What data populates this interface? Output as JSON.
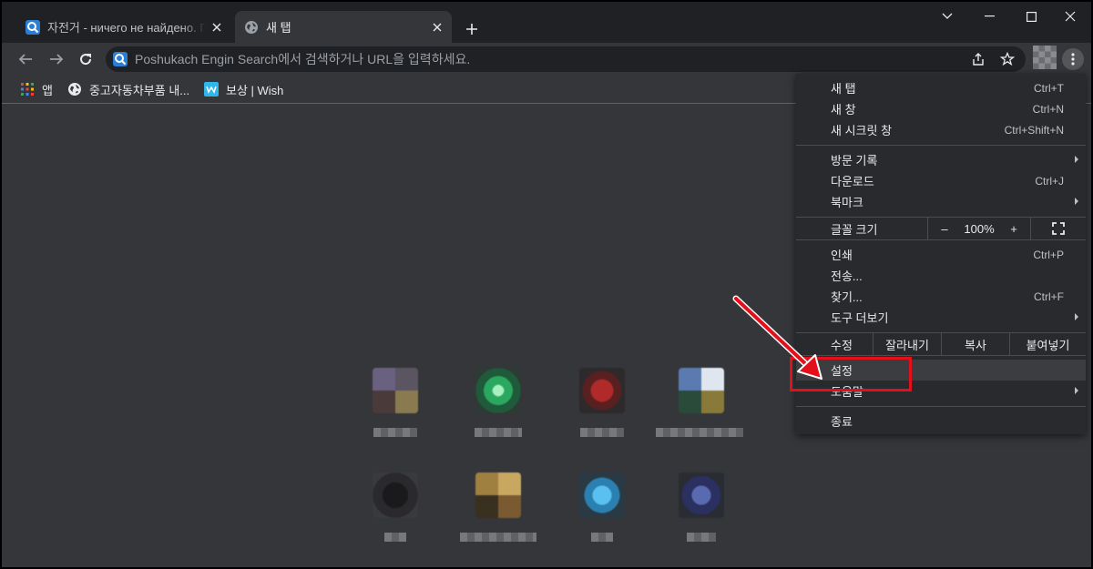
{
  "tabs": [
    {
      "title": "자전거 - ничего не найдено. П",
      "icon": "search-logo-icon"
    },
    {
      "title": "새 탭",
      "icon": "globe-icon"
    }
  ],
  "omnibox": {
    "placeholder": "Poshukach Engin Search에서 검색하거나 URL을 입력하세요."
  },
  "bookmarks": [
    {
      "label": "앱",
      "icon": "apps-grid-icon"
    },
    {
      "label": "중고자동차부품 내...",
      "icon": "globe-icon"
    },
    {
      "label": "보상 | Wish",
      "icon": "wish-icon"
    }
  ],
  "menu": {
    "new_tab": {
      "label": "새 탭",
      "shortcut": "Ctrl+T"
    },
    "new_window": {
      "label": "새 창",
      "shortcut": "Ctrl+N"
    },
    "new_incognito": {
      "label": "새 시크릿 창",
      "shortcut": "Ctrl+Shift+N"
    },
    "history": {
      "label": "방문 기록"
    },
    "downloads": {
      "label": "다운로드",
      "shortcut": "Ctrl+J"
    },
    "bookmarks": {
      "label": "북마크"
    },
    "zoom": {
      "label": "글꼴 크기",
      "minus": "–",
      "value": "100%",
      "plus": "+"
    },
    "print": {
      "label": "인쇄",
      "shortcut": "Ctrl+P"
    },
    "cast": {
      "label": "전송..."
    },
    "find": {
      "label": "찾기...",
      "shortcut": "Ctrl+F"
    },
    "more_tools": {
      "label": "도구 더보기"
    },
    "edit": {
      "label": "수정",
      "cut": "잘라내기",
      "copy": "복사",
      "paste": "붙여넣기"
    },
    "settings": {
      "label": "설정"
    },
    "help": {
      "label": "도움말"
    },
    "exit": {
      "label": "종료"
    }
  },
  "colors": {
    "accent_red": "#e3101b",
    "menu_bg": "#292a2d",
    "toolbar_bg": "#35363a",
    "tabstrip_bg": "#202124"
  }
}
